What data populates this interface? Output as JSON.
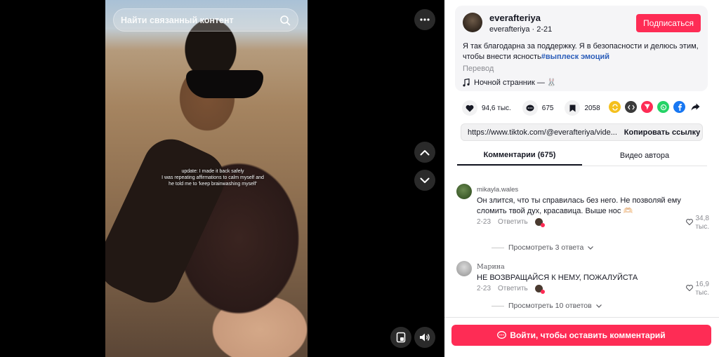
{
  "search": {
    "placeholder": "Найти связанный контент"
  },
  "video": {
    "caption_lines": [
      "update: I made it back safely",
      "I was repeating affirmations to calm myself and",
      "he told me to 'keep brainwashing myself'"
    ]
  },
  "author": {
    "name": "everafteriya",
    "sub": "everafteriya · 2-21",
    "follow_label": "Подписаться",
    "description": "Я так благодарна за поддержку. Я в безопасности и делюсь этим, чтобы внести ясность",
    "hashtag": "#выплеск эмоций",
    "translate_label": "Перевод",
    "music": "Ночной странник — 🐰"
  },
  "stats": {
    "likes": "94,6 тыс.",
    "comments": "675",
    "saves": "2058"
  },
  "share_colors": {
    "repost": "#f4c01e",
    "embed": "#3b3b3b",
    "send": "#fe2c55",
    "whatsapp": "#25d366",
    "facebook": "#1877f2"
  },
  "link": {
    "url": "https://www.tiktok.com/@everafteriya/vide...",
    "copy_label": "Копировать ссылку"
  },
  "tabs": [
    {
      "label": "Комментарии (675)"
    },
    {
      "label": "Видео автора"
    }
  ],
  "comments": [
    {
      "user": "mikayla.wales",
      "text": "Он злится, что ты справилась без него. Не позволяй ему сломить твой дух, красавица. Выше нос 🫶🏻",
      "date": "2-23",
      "reply": "Ответить",
      "likes_1": "34,8",
      "likes_2": "тыс.",
      "replies": "Просмотреть 3 ответа"
    },
    {
      "user": "Марина",
      "text": "НЕ ВОЗВРАЩАЙСЯ К НЕМУ, ПОЖАЛУЙСТА",
      "date": "2-23",
      "reply": "Ответить",
      "likes_1": "16,9",
      "likes_2": "тыс.",
      "replies": "Просмотреть 10 ответов"
    }
  ],
  "login": {
    "label": "Войти, чтобы оставить комментарий"
  }
}
